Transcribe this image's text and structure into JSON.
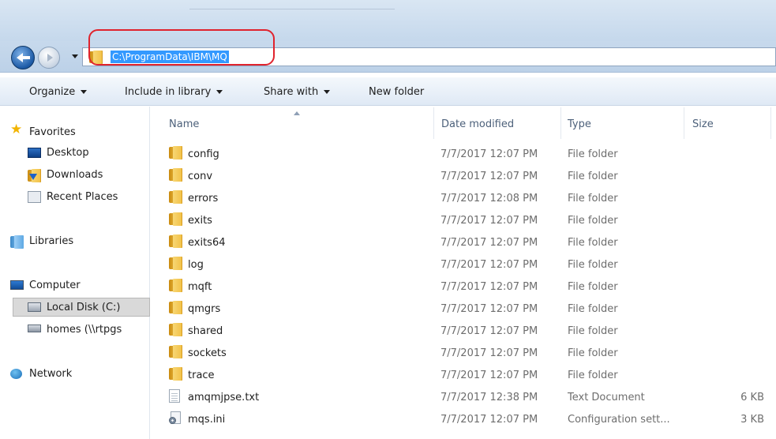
{
  "address": {
    "path": "C:\\ProgramData\\IBM\\MQ"
  },
  "toolbar": {
    "organize": "Organize",
    "include_in_library": "Include in library",
    "share_with": "Share with",
    "new_folder": "New folder"
  },
  "sidebar": {
    "favorites": "Favorites",
    "desktop": "Desktop",
    "downloads": "Downloads",
    "recent_places": "Recent Places",
    "libraries": "Libraries",
    "computer": "Computer",
    "local_disk": "Local Disk (C:)",
    "homes": "homes (\\\\rtpgs",
    "network": "Network"
  },
  "columns": {
    "name": "Name",
    "date_modified": "Date modified",
    "type": "Type",
    "size": "Size"
  },
  "files": [
    {
      "name": "config",
      "date": "7/7/2017 12:07 PM",
      "type": "File folder",
      "size": "",
      "icon": "folder"
    },
    {
      "name": "conv",
      "date": "7/7/2017 12:07 PM",
      "type": "File folder",
      "size": "",
      "icon": "folder"
    },
    {
      "name": "errors",
      "date": "7/7/2017 12:08 PM",
      "type": "File folder",
      "size": "",
      "icon": "folder"
    },
    {
      "name": "exits",
      "date": "7/7/2017 12:07 PM",
      "type": "File folder",
      "size": "",
      "icon": "folder"
    },
    {
      "name": "exits64",
      "date": "7/7/2017 12:07 PM",
      "type": "File folder",
      "size": "",
      "icon": "folder"
    },
    {
      "name": "log",
      "date": "7/7/2017 12:07 PM",
      "type": "File folder",
      "size": "",
      "icon": "folder"
    },
    {
      "name": "mqft",
      "date": "7/7/2017 12:07 PM",
      "type": "File folder",
      "size": "",
      "icon": "folder"
    },
    {
      "name": "qmgrs",
      "date": "7/7/2017 12:07 PM",
      "type": "File folder",
      "size": "",
      "icon": "folder"
    },
    {
      "name": "shared",
      "date": "7/7/2017 12:07 PM",
      "type": "File folder",
      "size": "",
      "icon": "folder"
    },
    {
      "name": "sockets",
      "date": "7/7/2017 12:07 PM",
      "type": "File folder",
      "size": "",
      "icon": "folder"
    },
    {
      "name": "trace",
      "date": "7/7/2017 12:07 PM",
      "type": "File folder",
      "size": "",
      "icon": "folder"
    },
    {
      "name": "amqmjpse.txt",
      "date": "7/7/2017 12:38 PM",
      "type": "Text Document",
      "size": "6 KB",
      "icon": "text-document"
    },
    {
      "name": "mqs.ini",
      "date": "7/7/2017 12:07 PM",
      "type": "Configuration sett...",
      "size": "3 KB",
      "icon": "config-file"
    }
  ],
  "colors": {
    "selection": "#3399ff",
    "annotation_circle": "#e0232d"
  }
}
